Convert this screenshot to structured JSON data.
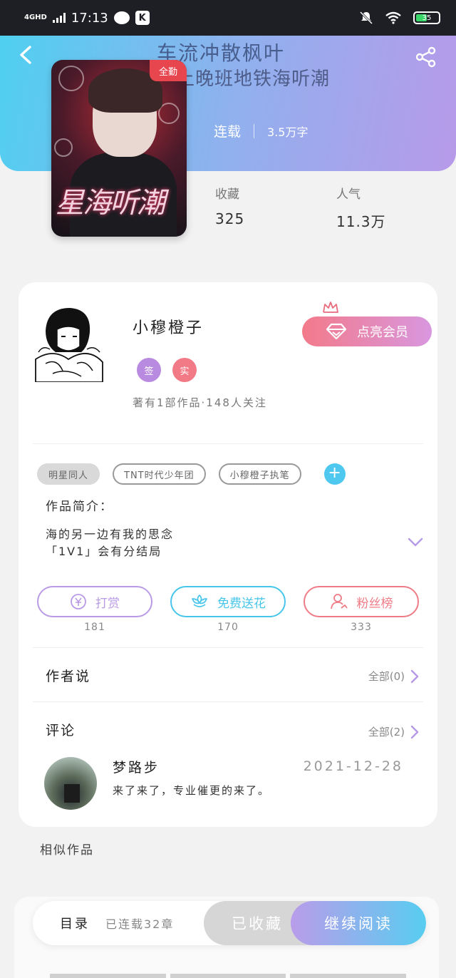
{
  "status_bar": {
    "network": "4GHD",
    "time": "17:13",
    "battery": "35",
    "colors": {
      "battery_fill": "#3bd66a"
    }
  },
  "header": {
    "title_line1": "车流冲散枫叶",
    "title_line2": "星上晚班地铁海听潮",
    "status": "连载",
    "word_count": "3.5万字",
    "cover_ribbon": "全勤",
    "cover_title": "星海听潮",
    "icons": {
      "back": "back-arrow-icon",
      "share": "share-icon"
    },
    "colors": {
      "gradient_start": "#4fd0f0",
      "gradient_end": "#b79ae9"
    }
  },
  "stats": [
    {
      "label": "收藏",
      "value": "325"
    },
    {
      "label": "人气",
      "value": "11.3万"
    }
  ],
  "author": {
    "name": "小穆橙子",
    "badges": [
      "签",
      "实"
    ],
    "info": "著有1部作品·148人关注",
    "vip_button": "点亮会员",
    "colors": {
      "badge_sign": "#b98be0",
      "badge_real": "#f27a86"
    }
  },
  "tags": {
    "items": [
      "明星同人",
      "TNT时代少年团",
      "小穆橙子执笔"
    ],
    "add": "+"
  },
  "intro": {
    "label": "作品简介：",
    "line1": "海的另一边有我的思念",
    "line2": "「1V1」会有分结局"
  },
  "actions": [
    {
      "label": "打赏",
      "count": "181",
      "icon": "coin-icon",
      "color": "#b99ae6"
    },
    {
      "label": "免费送花",
      "count": "170",
      "icon": "flower-icon",
      "color": "#47c6ea"
    },
    {
      "label": "粉丝榜",
      "count": "333",
      "icon": "fan-user-icon",
      "color": "#ef7b86"
    }
  ],
  "author_says": {
    "title": "作者说",
    "more": "全部(0)"
  },
  "comments": {
    "title": "评论",
    "more": "全部(2)",
    "items": [
      {
        "user": "梦路步",
        "date": "2021-12-28",
        "text": "来了来了，专业催更的来了。"
      }
    ]
  },
  "similar": {
    "title": "相似作品"
  },
  "bottom_bar": {
    "toc_label": "目录",
    "toc_count": "已连载32章",
    "collected": "已收藏",
    "continue_reading": "继续阅读"
  }
}
